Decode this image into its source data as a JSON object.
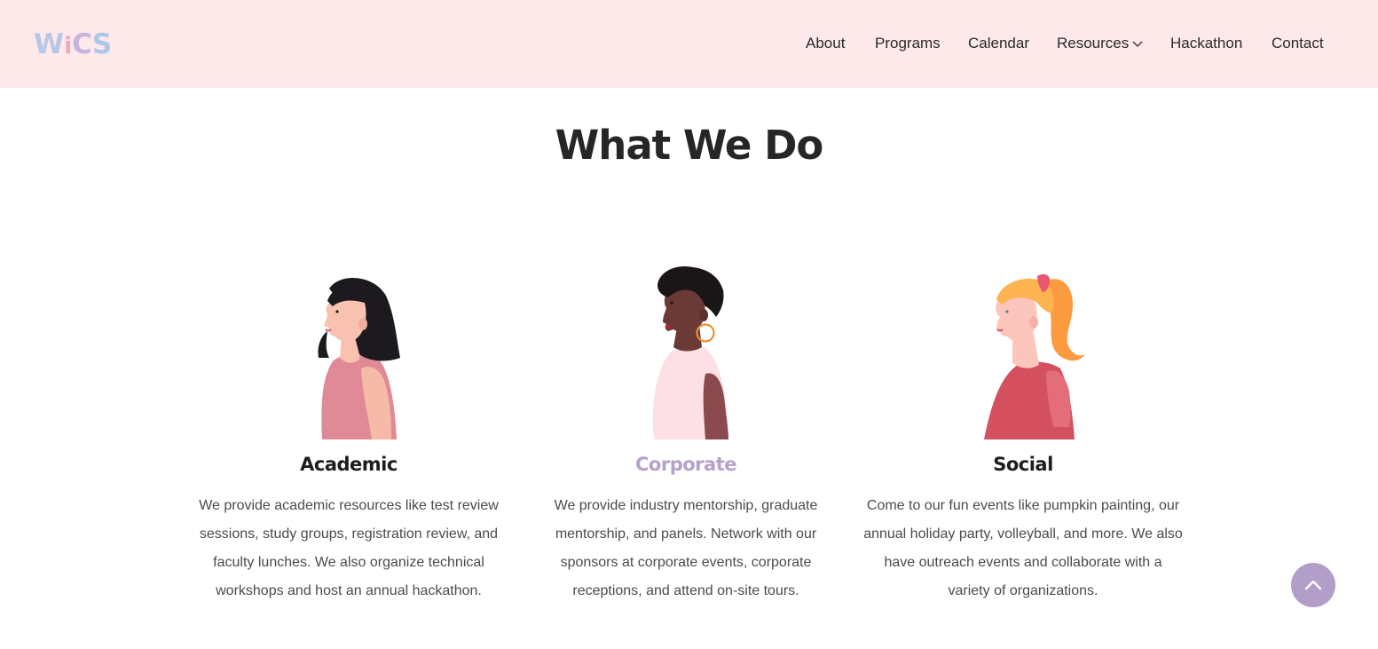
{
  "header": {
    "logo": {
      "letters": [
        "W",
        "i",
        "C",
        "S"
      ],
      "colors": [
        "#b8c6e6",
        "#f2a7b8",
        "#c3b3de",
        "#aac7e8"
      ]
    },
    "nav": [
      {
        "label": "About"
      },
      {
        "label": "Programs"
      },
      {
        "label": "Calendar"
      },
      {
        "label": "Resources",
        "has_dropdown": true,
        "icon": "chevron-down-icon"
      },
      {
        "label": "Hackathon"
      },
      {
        "label": "Contact"
      }
    ]
  },
  "main": {
    "title": "What We Do",
    "columns": [
      {
        "title": "Academic",
        "description": "We provide academic resources like test review sessions, study groups, registration review, and faculty lunches. We also organize technical workshops and host an annual hackathon.",
        "illustration": "woman-black-bob-pink-top-illustration"
      },
      {
        "title": "Corporate",
        "description": "We provide industry mentorship, graduate mentorship, and panels. Network with our sponsors at corporate events, corporate receptions, and attend on-site tours.",
        "illustration": "woman-short-curly-hair-hoop-earring-illustration"
      },
      {
        "title": "Social",
        "description": "Come to our fun events like pumpkin painting, our annual holiday party, volleyball, and more. We also have outreach events and collaborate with a variety of organizations.",
        "illustration": "woman-orange-ponytail-red-shirt-illustration"
      }
    ]
  },
  "scroll_top": {
    "icon": "chevron-up-icon",
    "color": "#b39dc9"
  },
  "colors": {
    "header_bg": "#fde8ea",
    "accent": "#b7a0c9"
  }
}
